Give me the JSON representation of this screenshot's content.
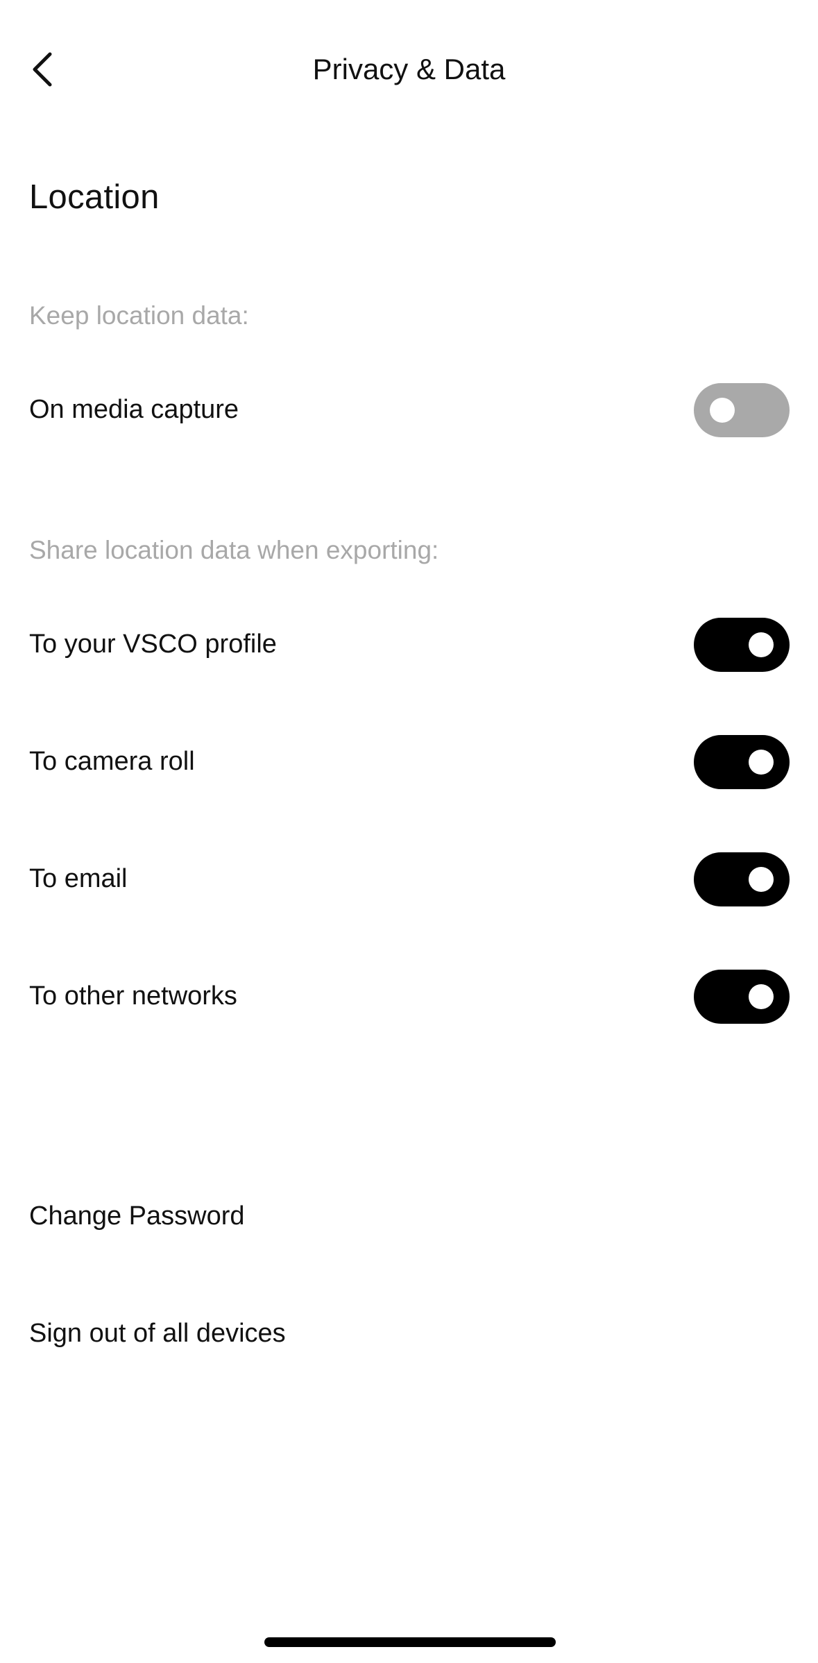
{
  "header": {
    "title": "Privacy & Data",
    "back_icon": "chevron-left-icon"
  },
  "location": {
    "title": "Location",
    "keep_label": "Keep location data:",
    "keep_items": [
      {
        "label": "On media capture",
        "enabled": false
      }
    ],
    "share_label": "Share location data when exporting:",
    "share_items": [
      {
        "label": "To your VSCO profile",
        "enabled": true
      },
      {
        "label": "To camera roll",
        "enabled": true
      },
      {
        "label": "To email",
        "enabled": true
      },
      {
        "label": "To other networks",
        "enabled": true
      }
    ]
  },
  "account": {
    "change_password": "Change Password",
    "sign_out_all": "Sign out of all devices"
  },
  "colors": {
    "toggle_on": "#000000",
    "toggle_off": "#a9a9a9",
    "group_label": "#a8a8a8",
    "text": "#111111"
  }
}
